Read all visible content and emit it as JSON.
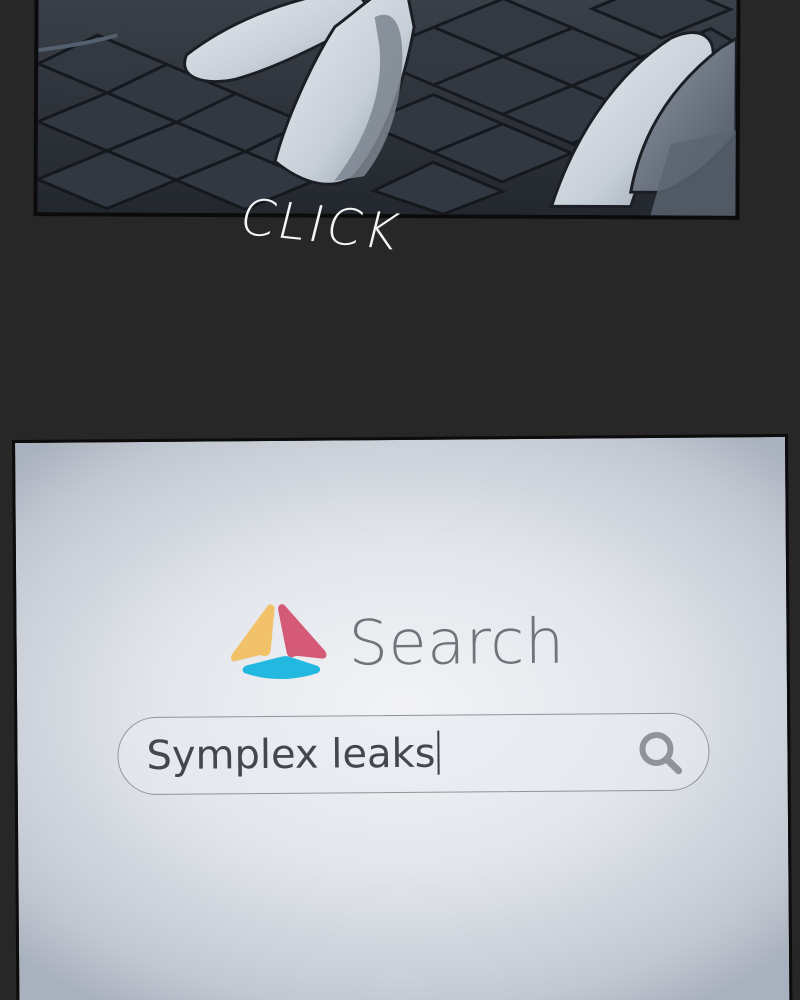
{
  "comic": {
    "sound_effect": "CLICK"
  },
  "search_screen": {
    "title": "Search",
    "logo_icon": "tri-petal-logo-icon",
    "query": "Symplex leaks",
    "search_icon": "magnifier-icon",
    "colors": {
      "logo_yellow": "#f2c26a",
      "logo_pink": "#d45a78",
      "logo_cyan": "#22b8e0",
      "title_gray": "#6f747a"
    }
  }
}
